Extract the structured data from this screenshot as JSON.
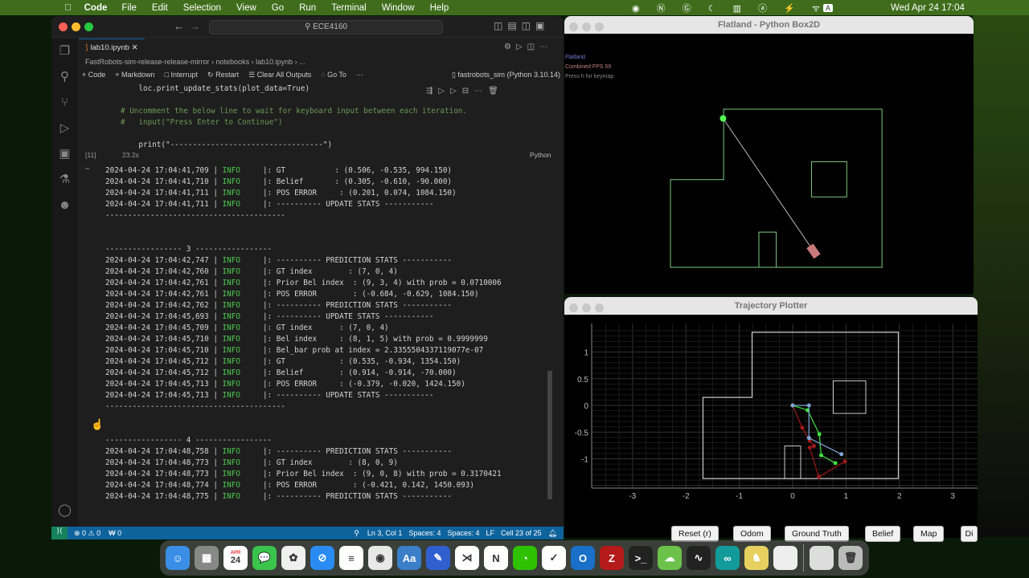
{
  "menubar": {
    "app": "Code",
    "items": [
      "File",
      "Edit",
      "Selection",
      "View",
      "Go",
      "Run",
      "Terminal",
      "Window",
      "Help"
    ],
    "clock": "Wed Apr 24  17:04",
    "kbd": "A"
  },
  "vscode": {
    "search": "ECE4160",
    "tab": "lab10.ipynb",
    "breadcrumb": [
      "FastRobots-sim-release-release-mirror",
      "notebooks",
      "lab10.ipynb",
      "..."
    ],
    "toolbar": {
      "code": "+ Code",
      "markdown": "+ Markdown",
      "interrupt": "Interrupt",
      "restart": "Restart",
      "clear": "Clear All Outputs",
      "goto": "Go To",
      "kernel": "fastrobots_sim (Python 3.10.14)"
    },
    "code_lines": [
      "    loc.print_update_stats(plot_data=True)",
      "",
      "# Uncomment the below line to wait for keyboard input between each iteration.",
      "#   input(\"Press Enter to Continue\")",
      "",
      "    print(\"----------------------------------\")"
    ],
    "cell_exec": "[11]",
    "cell_time": "23.2s",
    "cell_lang": "Python",
    "log": [
      {
        "ts": "2024-04-24 17:04:41,709",
        "lvl": "INFO",
        "msg": "|: GT           : (0.506, -0.535, 994.150)"
      },
      {
        "ts": "2024-04-24 17:04:41,710",
        "lvl": "INFO",
        "msg": "|: Belief       : (0.305, -0.610, -90.000)"
      },
      {
        "ts": "2024-04-24 17:04:41,711",
        "lvl": "INFO",
        "msg": "|: POS ERROR     : (0.201, 0.074, 1084.150)"
      },
      {
        "ts": "2024-04-24 17:04:41,711",
        "lvl": "INFO",
        "msg": "|: ---------- UPDATE STATS -----------"
      },
      {
        "text": "----------------------------------------"
      },
      {
        "text": ""
      },
      {
        "text": ""
      },
      {
        "text": "----------------- 3 -----------------"
      },
      {
        "ts": "2024-04-24 17:04:42,747",
        "lvl": "INFO",
        "msg": "|: ---------- PREDICTION STATS -----------"
      },
      {
        "ts": "2024-04-24 17:04:42,760",
        "lvl": "INFO",
        "msg": "|: GT index        : (7, 0, 4)"
      },
      {
        "ts": "2024-04-24 17:04:42,761",
        "lvl": "INFO",
        "msg": "|: Prior Bel index  : (9, 3, 4) with prob = 0.0710006"
      },
      {
        "ts": "2024-04-24 17:04:42,761",
        "lvl": "INFO",
        "msg": "|: POS ERROR        : (-0.684, -0.629, 1084.150)"
      },
      {
        "ts": "2024-04-24 17:04:42,762",
        "lvl": "INFO",
        "msg": "|: ---------- PREDICTION STATS -----------"
      },
      {
        "ts": "2024-04-24 17:04:45,693",
        "lvl": "INFO",
        "msg": "|: ---------- UPDATE STATS -----------"
      },
      {
        "ts": "2024-04-24 17:04:45,709",
        "lvl": "INFO",
        "msg": "|: GT index      : (7, 0, 4)"
      },
      {
        "ts": "2024-04-24 17:04:45,710",
        "lvl": "INFO",
        "msg": "|: Bel index     : (8, 1, 5) with prob = 0.9999999"
      },
      {
        "ts": "2024-04-24 17:04:45,710",
        "lvl": "INFO",
        "msg": "|: Bel_bar prob at index = 2.3355504337119077e-07"
      },
      {
        "ts": "2024-04-24 17:04:45,712",
        "lvl": "INFO",
        "msg": "|: GT            : (0.535, -0.934, 1354.150)"
      },
      {
        "ts": "2024-04-24 17:04:45,712",
        "lvl": "INFO",
        "msg": "|: Belief        : (0.914, -0.914, -70.000)"
      },
      {
        "ts": "2024-04-24 17:04:45,713",
        "lvl": "INFO",
        "msg": "|: POS ERROR     : (-0.379, -0.020, 1424.150)"
      },
      {
        "ts": "2024-04-24 17:04:45,713",
        "lvl": "INFO",
        "msg": "|: ---------- UPDATE STATS -----------"
      },
      {
        "text": "----------------------------------------"
      },
      {
        "text": ""
      },
      {
        "text": ""
      },
      {
        "text": "----------------- 4 -----------------"
      },
      {
        "ts": "2024-04-24 17:04:48,758",
        "lvl": "INFO",
        "msg": "|: ---------- PREDICTION STATS -----------"
      },
      {
        "ts": "2024-04-24 17:04:48,773",
        "lvl": "INFO",
        "msg": "|: GT index        : (8, 0, 9)"
      },
      {
        "ts": "2024-04-24 17:04:48,773",
        "lvl": "INFO",
        "msg": "|: Prior Bel index  : (9, 0, 8) with prob = 0.3170421"
      },
      {
        "ts": "2024-04-24 17:04:48,774",
        "lvl": "INFO",
        "msg": "|: POS ERROR        : (-0.421, 0.142, 1450.093)"
      },
      {
        "ts": "2024-04-24 17:04:48,775",
        "lvl": "INFO",
        "msg": "|: ---------- PREDICTION STATS -----------"
      }
    ],
    "status": {
      "errors": "⊗ 0 ⚠ 0",
      "ports": "₩ 0",
      "pos": "Ln 3, Col 1",
      "spaces1": "Spaces: 4",
      "spaces2": "Spaces: 4",
      "eol": "LF",
      "cell": "Cell 23 of 25"
    }
  },
  "flatland": {
    "title": "Flatland - Python Box2D",
    "hud": [
      "Flatland",
      "Combined FPS 59",
      "Press h for keymap"
    ],
    "robot": [
      0.795,
      -1.09
    ],
    "ray_end": [
      -0.77,
      1.21
    ]
  },
  "plotter": {
    "title": "Trajectory Plotter",
    "xticks": [
      -3,
      -2,
      -1,
      0,
      1,
      2,
      3
    ],
    "yticks": [
      1,
      0.5,
      0,
      -0.5,
      -1
    ],
    "map": {
      "outer": [
        [
          -1.68,
          -1.37
        ],
        [
          -1.68,
          0.15
        ],
        [
          -0.76,
          0.15
        ],
        [
          -0.76,
          1.37
        ],
        [
          1.98,
          1.37
        ],
        [
          1.98,
          -1.37
        ]
      ],
      "boxes": [
        [
          [
            0.76,
            -0.15
          ],
          [
            1.37,
            0.46
          ]
        ],
        [
          [
            -0.15,
            -1.37
          ],
          [
            0.15,
            -0.76
          ]
        ]
      ]
    },
    "series": [
      {
        "name": "Odom",
        "color": "#a01818",
        "points": [
          [
            0,
            0
          ],
          [
            0.18,
            -0.42
          ],
          [
            0.32,
            -0.66
          ],
          [
            0.4,
            -0.76
          ],
          [
            0.32,
            -0.79
          ],
          [
            0.49,
            -1.34
          ],
          [
            0.98,
            -1.05
          ]
        ]
      },
      {
        "name": "Ground Truth",
        "color": "#3ee03e",
        "points": [
          [
            0,
            0
          ],
          [
            0.28,
            -0.09
          ],
          [
            0.5,
            -0.54
          ],
          [
            0.535,
            -0.934
          ],
          [
            0.8,
            -1.08
          ]
        ]
      },
      {
        "name": "Belief",
        "color": "#7fa6d6",
        "points": [
          [
            0,
            0
          ],
          [
            0.305,
            0
          ],
          [
            0.305,
            -0.61
          ],
          [
            0.914,
            -0.914
          ]
        ]
      }
    ],
    "buttons": [
      "Reset (r)",
      "Odom",
      "Ground Truth",
      "Belief",
      "Map",
      "Di"
    ]
  },
  "dock": [
    {
      "n": "finder",
      "c": "#3a8ee6",
      "t": "☺"
    },
    {
      "n": "launchpad",
      "c": "#888",
      "t": "▦"
    },
    {
      "n": "calendar",
      "c": "#fff",
      "t": "24"
    },
    {
      "n": "messages",
      "c": "#3bc44b",
      "t": "💬"
    },
    {
      "n": "photos",
      "c": "#f0f0f0",
      "t": "✿"
    },
    {
      "n": "safari",
      "c": "#2a8bf2",
      "t": "⊘"
    },
    {
      "n": "reminders",
      "c": "#fff",
      "t": "≡"
    },
    {
      "n": "chrome",
      "c": "#e8e8e8",
      "t": "◉"
    },
    {
      "n": "dictionary",
      "c": "#3b7fc8",
      "t": "Aa"
    },
    {
      "n": "pencil-app",
      "c": "#3060d0",
      "t": "✎"
    },
    {
      "n": "vscode",
      "c": "#fff",
      "t": "⋊"
    },
    {
      "n": "notion",
      "c": "#fff",
      "t": "N"
    },
    {
      "n": "wechat",
      "c": "#2dc100",
      "t": "◔"
    },
    {
      "n": "tasks",
      "c": "#fff",
      "t": "✓"
    },
    {
      "n": "outlook",
      "c": "#1a6fc9",
      "t": "O"
    },
    {
      "n": "filezilla",
      "c": "#b51a1a",
      "t": "Z"
    },
    {
      "n": "terminal",
      "c": "#222",
      "t": ">_"
    },
    {
      "n": "cloud-app",
      "c": "#6cc24a",
      "t": "☁"
    },
    {
      "n": "activity-monitor",
      "c": "#222",
      "t": "∿"
    },
    {
      "n": "arduino",
      "c": "#139a9a",
      "t": "∞"
    },
    {
      "n": "cyberduck",
      "c": "#e8d060",
      "t": "♞"
    },
    {
      "n": "document",
      "c": "#eee",
      "t": ""
    },
    {
      "n": "image-file",
      "c": "#ddd",
      "t": ""
    },
    {
      "n": "trash",
      "c": "#bbb",
      "t": "🗑"
    }
  ],
  "dock_calendar_month": "APR"
}
